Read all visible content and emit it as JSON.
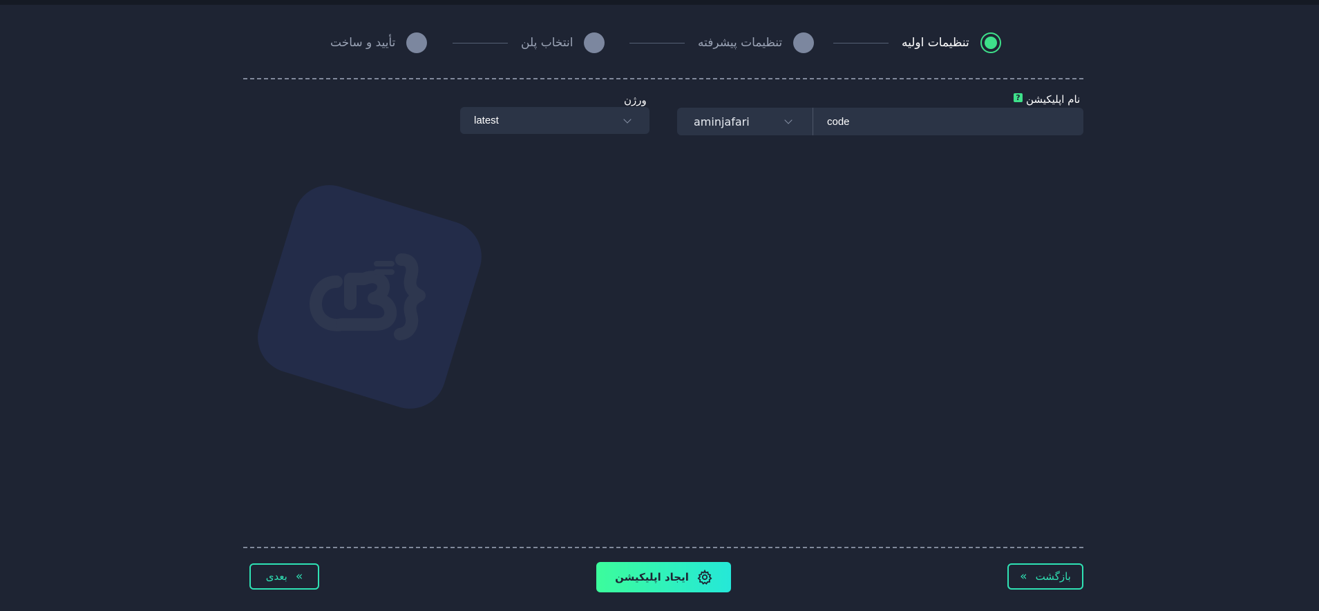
{
  "stepper": {
    "steps": [
      {
        "label": "تنظیمات اولیه",
        "active": true
      },
      {
        "label": "تنظیمات پیشرفته",
        "active": false
      },
      {
        "label": "انتخاب پلن",
        "active": false
      },
      {
        "label": "تأیید و ساخت",
        "active": false
      }
    ]
  },
  "form": {
    "app_name_label": "نام اپلیکیشن",
    "help_icon_glyph": "?",
    "namespace_value": "aminjafari",
    "app_name_value": "code",
    "version_label": "ورژن",
    "version_value": "latest"
  },
  "actions": {
    "back_label": "بازگشت",
    "create_label": "ایجاد اپلیکیشن",
    "next_label": "بعدی",
    "back_icon": "«",
    "next_icon": "«"
  },
  "colors": {
    "background": "#1e2433",
    "accent_green": "#3ee08a",
    "accent_cyan": "#2fe2b4",
    "field_bg": "#2b3446"
  }
}
